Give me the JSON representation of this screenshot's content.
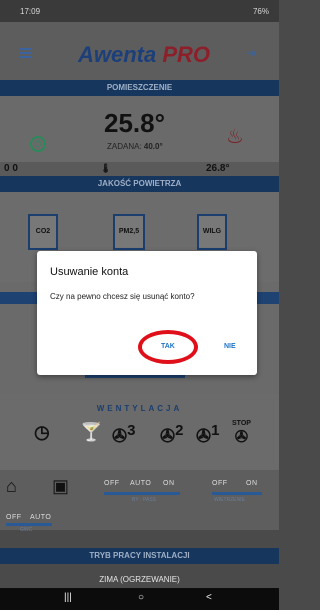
{
  "status_bar": {
    "time": "17:09",
    "battery": "76%"
  },
  "header": {
    "logo_main": "Awenta",
    "logo_accent": "PRO"
  },
  "room": {
    "section_title": "POMIESZCZENIE",
    "temperature": "25.8°",
    "setpoint_label": "ZADANA:",
    "setpoint_value": "40.0°",
    "left_reading": "0 0",
    "right_reading": "26.8°"
  },
  "air_quality": {
    "section_title": "JAKOŚĆ POWIETRZA",
    "sensors": [
      "CO2",
      "PM2,5",
      "WILG"
    ]
  },
  "ventilation": {
    "section_title": "WENTYLACJA",
    "levels": [
      "3",
      "2",
      "1"
    ],
    "stop_label": "STOP"
  },
  "toggles": {
    "off": "OFF",
    "auto": "AUTO",
    "on": "ON",
    "bypass_label": "BY - PASS",
    "wietrzenie_label": "WIETRZENIE",
    "gwc_label": "GWC"
  },
  "mode": {
    "section_title": "TRYB PRACY INSTALACJI",
    "value": "ZIMA (OGRZEWANIE)"
  },
  "dialog": {
    "title": "Usuwanie konta",
    "message": "Czy na pewno chcesz się usunąć konto?",
    "confirm": "TAK",
    "cancel": "NIE"
  },
  "nav": {
    "recent": "|||",
    "home": "○",
    "back": "<"
  },
  "colors": {
    "accent": "#1f74c8",
    "header_bar": "#16365e",
    "highlight_ring": "#e0101a"
  }
}
